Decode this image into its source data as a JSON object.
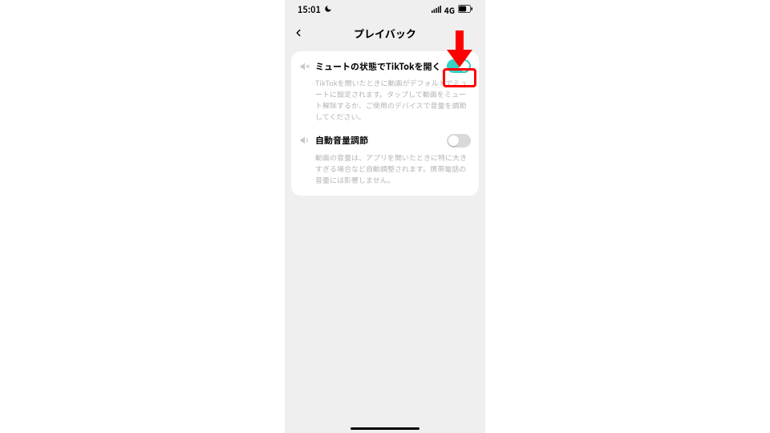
{
  "status": {
    "time": "15:01",
    "net_label": "4G"
  },
  "nav": {
    "title": "プレイバック"
  },
  "settings": [
    {
      "icon": "volume-mute-icon",
      "label": "ミュートの状態でTikTokを開く",
      "description": "TikTokを開いたときに動画がデフォルトでミュートに設定されます。タップして動画をミュート解除するか、ご使用のデバイスで音量を調節してください。",
      "on": true
    },
    {
      "icon": "volume-icon",
      "label": "自動音量調節",
      "description": "動画の音量は、アプリを開いたときに特に大きすぎる場合など自動調整されます。携帯電話の音量には影響しません。",
      "on": false
    }
  ],
  "annotation": {
    "target": "settings.0.toggle"
  }
}
